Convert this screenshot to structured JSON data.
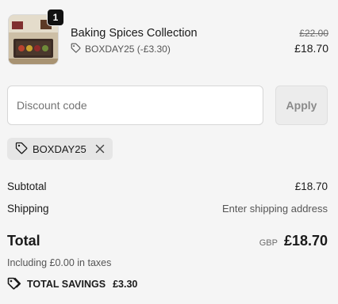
{
  "line_item": {
    "quantity": "1",
    "name": "Baking Spices Collection",
    "discount_label": "BOXDAY25 (-£3.30)",
    "original_price": "£22.00",
    "price": "£18.70",
    "thumbnail_icon": "product-thumbnail"
  },
  "discount_form": {
    "placeholder": "Discount code",
    "value": "",
    "apply_label": "Apply"
  },
  "applied_code": {
    "code": "BOXDAY25",
    "tag_icon": "tag-icon",
    "remove_icon": "close-icon"
  },
  "summary": {
    "subtotal_label": "Subtotal",
    "subtotal_value": "£18.70",
    "shipping_label": "Shipping",
    "shipping_value": "Enter shipping address",
    "total_label": "Total",
    "currency": "GBP",
    "total_value": "£18.70",
    "taxes_note": "Including £0.00 in taxes",
    "savings_label": "TOTAL SAVINGS",
    "savings_value": "£3.30"
  },
  "colors": {
    "background": "#f5f5f5",
    "text": "#1a1a1a",
    "muted_text": "#555555",
    "badge": "#111111",
    "chip_background": "#e6e6e6",
    "apply_button": "#ececec"
  }
}
